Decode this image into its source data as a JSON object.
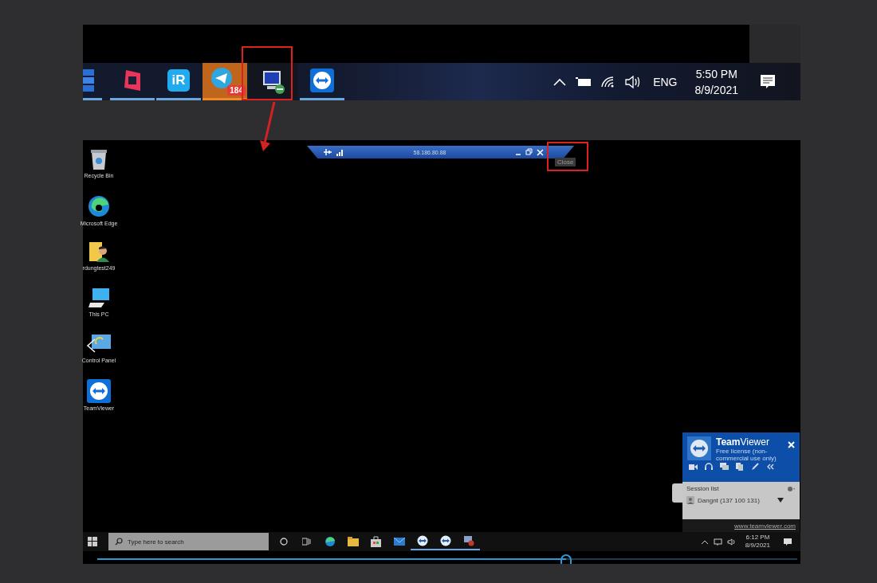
{
  "top_taskbar": {
    "apps": [
      {
        "kind": "tiles",
        "selected": false
      },
      {
        "kind": "red-square",
        "selected": false
      },
      {
        "kind": "ir",
        "text": "iR",
        "selected": false
      },
      {
        "kind": "telegram",
        "badge": "184",
        "selected": true
      },
      {
        "kind": "remote-desktop",
        "selected": false
      },
      {
        "kind": "teamviewer",
        "selected": false
      }
    ],
    "tray": {
      "language": "ENG",
      "time": "5:50 PM",
      "date": "8/9/2021"
    }
  },
  "remote_bar": {
    "address": "58.186.80.88",
    "tooltip": "Close"
  },
  "desktop_icons": [
    {
      "kind": "recycle",
      "label": "Recycle Bin"
    },
    {
      "kind": "edge",
      "label": "Microsoft Edge"
    },
    {
      "kind": "user-folder",
      "label": "rdungtest249"
    },
    {
      "kind": "pc",
      "label": "This PC"
    },
    {
      "kind": "control-panel",
      "label": "Control Panel"
    },
    {
      "kind": "teamviewer",
      "label": "TeamViewer"
    }
  ],
  "teamviewer_panel": {
    "title": "**Team**Viewer",
    "license": "Free license (non-commercial use only)",
    "session_list": "Session list",
    "session": "Dangnt (137 100 131)",
    "link": "www.teamviewer.com"
  },
  "bottom_taskbar": {
    "search_placeholder": "Type here to search",
    "apps": [
      {
        "kind": "cortana"
      },
      {
        "kind": "task-view"
      },
      {
        "kind": "edge"
      },
      {
        "kind": "folder"
      },
      {
        "kind": "store"
      },
      {
        "kind": "mail"
      },
      {
        "kind": "teamviewer"
      },
      {
        "kind": "teamviewer"
      },
      {
        "kind": "remote-desktop"
      }
    ],
    "time": "6:12 PM",
    "date": "8/9/2021"
  },
  "video_progress": {
    "level": 0.67
  }
}
